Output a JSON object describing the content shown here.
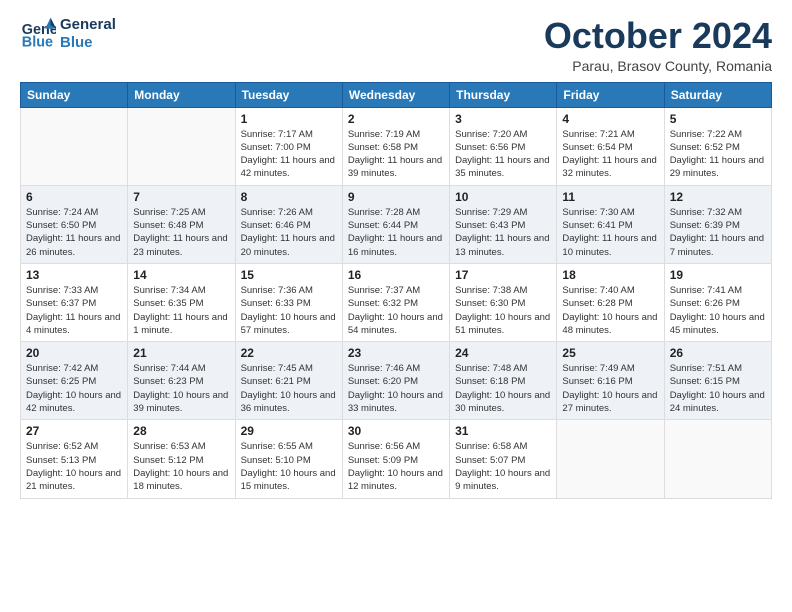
{
  "logo": {
    "line1": "General",
    "line2": "Blue"
  },
  "title": "October 2024",
  "subtitle": "Parau, Brasov County, Romania",
  "days_of_week": [
    "Sunday",
    "Monday",
    "Tuesday",
    "Wednesday",
    "Thursday",
    "Friday",
    "Saturday"
  ],
  "weeks": [
    [
      {
        "num": "",
        "detail": ""
      },
      {
        "num": "",
        "detail": ""
      },
      {
        "num": "1",
        "detail": "Sunrise: 7:17 AM\nSunset: 7:00 PM\nDaylight: 11 hours and 42 minutes."
      },
      {
        "num": "2",
        "detail": "Sunrise: 7:19 AM\nSunset: 6:58 PM\nDaylight: 11 hours and 39 minutes."
      },
      {
        "num": "3",
        "detail": "Sunrise: 7:20 AM\nSunset: 6:56 PM\nDaylight: 11 hours and 35 minutes."
      },
      {
        "num": "4",
        "detail": "Sunrise: 7:21 AM\nSunset: 6:54 PM\nDaylight: 11 hours and 32 minutes."
      },
      {
        "num": "5",
        "detail": "Sunrise: 7:22 AM\nSunset: 6:52 PM\nDaylight: 11 hours and 29 minutes."
      }
    ],
    [
      {
        "num": "6",
        "detail": "Sunrise: 7:24 AM\nSunset: 6:50 PM\nDaylight: 11 hours and 26 minutes."
      },
      {
        "num": "7",
        "detail": "Sunrise: 7:25 AM\nSunset: 6:48 PM\nDaylight: 11 hours and 23 minutes."
      },
      {
        "num": "8",
        "detail": "Sunrise: 7:26 AM\nSunset: 6:46 PM\nDaylight: 11 hours and 20 minutes."
      },
      {
        "num": "9",
        "detail": "Sunrise: 7:28 AM\nSunset: 6:44 PM\nDaylight: 11 hours and 16 minutes."
      },
      {
        "num": "10",
        "detail": "Sunrise: 7:29 AM\nSunset: 6:43 PM\nDaylight: 11 hours and 13 minutes."
      },
      {
        "num": "11",
        "detail": "Sunrise: 7:30 AM\nSunset: 6:41 PM\nDaylight: 11 hours and 10 minutes."
      },
      {
        "num": "12",
        "detail": "Sunrise: 7:32 AM\nSunset: 6:39 PM\nDaylight: 11 hours and 7 minutes."
      }
    ],
    [
      {
        "num": "13",
        "detail": "Sunrise: 7:33 AM\nSunset: 6:37 PM\nDaylight: 11 hours and 4 minutes."
      },
      {
        "num": "14",
        "detail": "Sunrise: 7:34 AM\nSunset: 6:35 PM\nDaylight: 11 hours and 1 minute."
      },
      {
        "num": "15",
        "detail": "Sunrise: 7:36 AM\nSunset: 6:33 PM\nDaylight: 10 hours and 57 minutes."
      },
      {
        "num": "16",
        "detail": "Sunrise: 7:37 AM\nSunset: 6:32 PM\nDaylight: 10 hours and 54 minutes."
      },
      {
        "num": "17",
        "detail": "Sunrise: 7:38 AM\nSunset: 6:30 PM\nDaylight: 10 hours and 51 minutes."
      },
      {
        "num": "18",
        "detail": "Sunrise: 7:40 AM\nSunset: 6:28 PM\nDaylight: 10 hours and 48 minutes."
      },
      {
        "num": "19",
        "detail": "Sunrise: 7:41 AM\nSunset: 6:26 PM\nDaylight: 10 hours and 45 minutes."
      }
    ],
    [
      {
        "num": "20",
        "detail": "Sunrise: 7:42 AM\nSunset: 6:25 PM\nDaylight: 10 hours and 42 minutes."
      },
      {
        "num": "21",
        "detail": "Sunrise: 7:44 AM\nSunset: 6:23 PM\nDaylight: 10 hours and 39 minutes."
      },
      {
        "num": "22",
        "detail": "Sunrise: 7:45 AM\nSunset: 6:21 PM\nDaylight: 10 hours and 36 minutes."
      },
      {
        "num": "23",
        "detail": "Sunrise: 7:46 AM\nSunset: 6:20 PM\nDaylight: 10 hours and 33 minutes."
      },
      {
        "num": "24",
        "detail": "Sunrise: 7:48 AM\nSunset: 6:18 PM\nDaylight: 10 hours and 30 minutes."
      },
      {
        "num": "25",
        "detail": "Sunrise: 7:49 AM\nSunset: 6:16 PM\nDaylight: 10 hours and 27 minutes."
      },
      {
        "num": "26",
        "detail": "Sunrise: 7:51 AM\nSunset: 6:15 PM\nDaylight: 10 hours and 24 minutes."
      }
    ],
    [
      {
        "num": "27",
        "detail": "Sunrise: 6:52 AM\nSunset: 5:13 PM\nDaylight: 10 hours and 21 minutes."
      },
      {
        "num": "28",
        "detail": "Sunrise: 6:53 AM\nSunset: 5:12 PM\nDaylight: 10 hours and 18 minutes."
      },
      {
        "num": "29",
        "detail": "Sunrise: 6:55 AM\nSunset: 5:10 PM\nDaylight: 10 hours and 15 minutes."
      },
      {
        "num": "30",
        "detail": "Sunrise: 6:56 AM\nSunset: 5:09 PM\nDaylight: 10 hours and 12 minutes."
      },
      {
        "num": "31",
        "detail": "Sunrise: 6:58 AM\nSunset: 5:07 PM\nDaylight: 10 hours and 9 minutes."
      },
      {
        "num": "",
        "detail": ""
      },
      {
        "num": "",
        "detail": ""
      }
    ]
  ]
}
